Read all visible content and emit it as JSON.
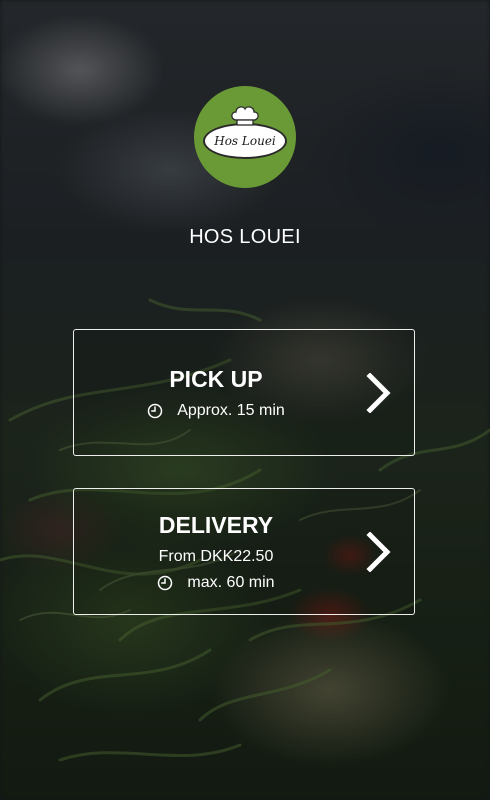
{
  "brand": {
    "logo_text": "Hos Louei",
    "name": "HOS LOUEI",
    "logo_color": "#6a9a36"
  },
  "options": {
    "pickup": {
      "title": "PICK UP",
      "time": "Approx. 15 min",
      "icons": [
        "clock-icon",
        "chevron-right-icon"
      ]
    },
    "delivery": {
      "title": "DELIVERY",
      "price": "From DKK22.50",
      "time": "max. 60 min",
      "icons": [
        "clock-icon",
        "chevron-right-icon"
      ]
    }
  }
}
